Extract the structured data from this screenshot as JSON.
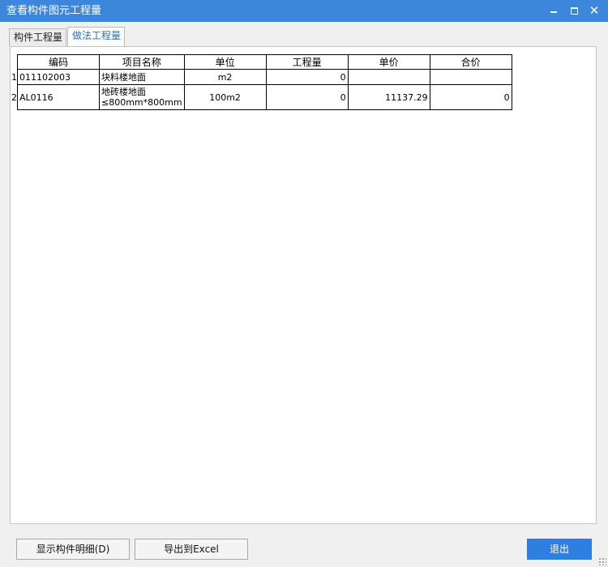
{
  "window": {
    "title": "查看构件图元工程量"
  },
  "tabs": [
    {
      "label": "构件工程量",
      "active": false
    },
    {
      "label": "做法工程量",
      "active": true
    }
  ],
  "table": {
    "columns": [
      "编码",
      "项目名称",
      "单位",
      "工程量",
      "单价",
      "合价"
    ],
    "rows": [
      {
        "num": "1",
        "code": "011102003",
        "name": "块料楼地面",
        "unit": "m2",
        "qty": "0",
        "price": "",
        "total": ""
      },
      {
        "num": "2",
        "code": "AL0116",
        "name": "地砖楼地面 ≤800mm*800mm",
        "unit": "100m2",
        "qty": "0",
        "price": "11137.29",
        "total": "0"
      }
    ]
  },
  "buttons": {
    "show_detail": "显示构件明细(D)",
    "export_excel": "导出到Excel",
    "exit": "退出"
  },
  "colors": {
    "titlebar": "#3c86db",
    "primary_button": "#2f7fe0",
    "active_tab_text": "#2f6fb5"
  }
}
